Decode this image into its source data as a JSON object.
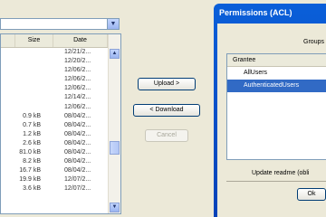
{
  "file_list": {
    "columns": [
      "Size",
      "Date"
    ],
    "rows": [
      {
        "size": "",
        "date": "12/21/2..."
      },
      {
        "size": "",
        "date": "12/20/2..."
      },
      {
        "size": "",
        "date": "12/06/2..."
      },
      {
        "size": "",
        "date": "12/06/2..."
      },
      {
        "size": "",
        "date": "12/06/2..."
      },
      {
        "size": "",
        "date": "12/14/2..."
      },
      {
        "size": "",
        "date": "12/06/2..."
      },
      {
        "size": "0.9 kB",
        "date": "08/04/2..."
      },
      {
        "size": "0.7 kB",
        "date": "08/04/2..."
      },
      {
        "size": "1.2 kB",
        "date": "08/04/2..."
      },
      {
        "size": "2.6 kB",
        "date": "08/04/2..."
      },
      {
        "size": "81.0 kB",
        "date": "08/04/2..."
      },
      {
        "size": "8.2 kB",
        "date": "08/04/2..."
      },
      {
        "size": "16.7 kB",
        "date": "08/04/2..."
      },
      {
        "size": "19.9 kB",
        "date": "12/07/2..."
      },
      {
        "size": "3.6 kB",
        "date": "12/07/2..."
      }
    ]
  },
  "buttons": {
    "upload": "Upload >",
    "download": "< Download",
    "cancel": "Cancel"
  },
  "dialog": {
    "title": "Permissions (ACL)",
    "groups_label": "Groups",
    "list_header": "Grantee",
    "grantees": [
      "AllUsers",
      "AuthenticatedUsers"
    ],
    "selected_index": 1,
    "update_text": "Update readme (obli",
    "ok": "Ok"
  }
}
